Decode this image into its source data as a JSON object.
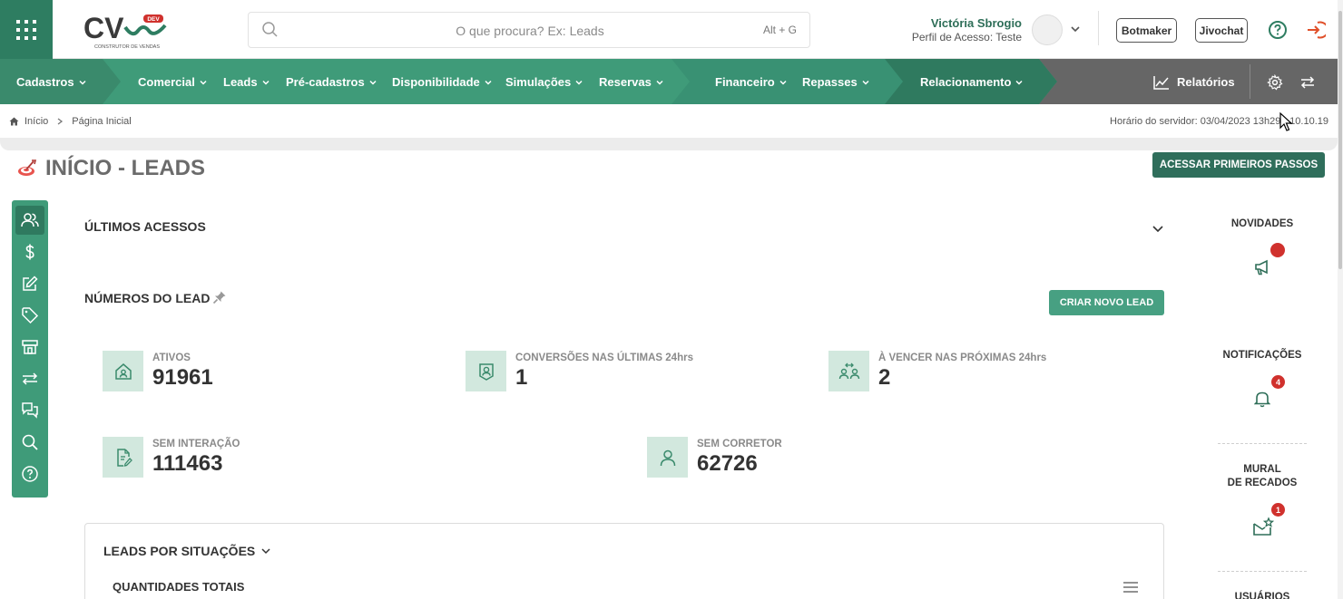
{
  "brand": {
    "logo_text": "CV",
    "logo_tag": "DEV",
    "logo_sub": "CONSTRUTOR DE VENDAS"
  },
  "search": {
    "placeholder": "O que procura? Ex: Leads",
    "shortcut": "Alt + G"
  },
  "user": {
    "name": "Victória Sbrogio",
    "profile": "Perfil de Acesso: Teste"
  },
  "top_actions": {
    "botmaker": "Botmaker",
    "jivochat": "Jivochat"
  },
  "nav": {
    "cadastros": "Cadastros",
    "comercial": "Comercial",
    "leads": "Leads",
    "pre_cadastros": "Pré-cadastros",
    "disponibilidade": "Disponibilidade",
    "simulacoes": "Simulações",
    "reservas": "Reservas",
    "financeiro": "Financeiro",
    "repasses": "Repasses",
    "relacionamento": "Relacionamento",
    "relatorios": "Relatórios"
  },
  "breadcrumb": {
    "home": "Início",
    "current": "Página Inicial"
  },
  "server_time": "Horário do servidor: 03/04/2023 13h29 - 10.10.19",
  "page": {
    "title": "INÍCIO - LEADS",
    "primeiros_passos": "ACESSAR PRIMEIROS PASSOS"
  },
  "sections": {
    "ultimos_acessos": "ÚLTIMOS ACESSOS",
    "numeros_lead": "NÚMEROS DO LEAD",
    "criar_lead": "CRIAR NOVO LEAD"
  },
  "stats": [
    {
      "label": "ATIVOS",
      "value": "91961",
      "icon": "house-icon"
    },
    {
      "label": "CONVERSÕES NAS ÚLTIMAS 24hrs",
      "value": "1",
      "icon": "user-badge-icon"
    },
    {
      "label": "À VENCER NAS PRÓXIMAS 24hrs",
      "value": "2",
      "icon": "users-transfer-icon"
    },
    {
      "label": "SEM INTERAÇÃO",
      "value": "111463",
      "icon": "document-edit-icon"
    },
    {
      "label": "SEM CORRETOR",
      "value": "62726",
      "icon": "user-icon"
    }
  ],
  "panel": {
    "title": "LEADS POR SITUAÇÕES",
    "subtitle": "QUANTIDADES TOTAIS"
  },
  "right": {
    "novidades": "NOVIDADES",
    "notificacoes": "NOTIFICAÇÕES",
    "notificacoes_count": "4",
    "mural_line1": "MURAL",
    "mural_line2": "DE RECADOS",
    "mural_count": "1",
    "usuarios": "USUÁRIOS"
  },
  "colors": {
    "primary": "#3f9b79",
    "dark": "#2f6e5b",
    "badge": "#d0312d",
    "gray_nav": "#666666"
  }
}
